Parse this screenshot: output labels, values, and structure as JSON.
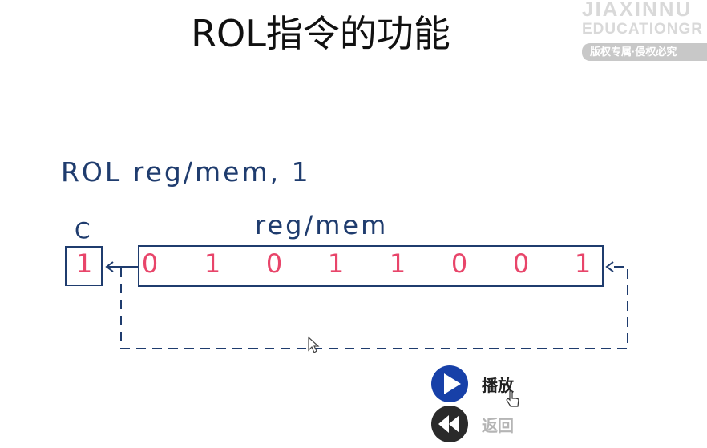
{
  "slide": {
    "title": "ROL指令的功能",
    "syntax": "ROL reg/mem, 1",
    "carry_label": "C",
    "register_label": "reg/mem",
    "carry_value": "1",
    "bits": [
      "0",
      "1",
      "0",
      "1",
      "1",
      "0",
      "0",
      "1"
    ]
  },
  "watermark": {
    "line1": "JIAXINNU",
    "line2": "EDUCATIONGR",
    "tag": "版权专属·侵权必究"
  },
  "controls": {
    "play_label": "播放",
    "back_label": "返回"
  },
  "colors": {
    "diagram_blue": "#1f3c6e",
    "bit_pink": "#e8456a",
    "button_blue": "#1740a8",
    "button_dark": "#2a2a2a"
  }
}
